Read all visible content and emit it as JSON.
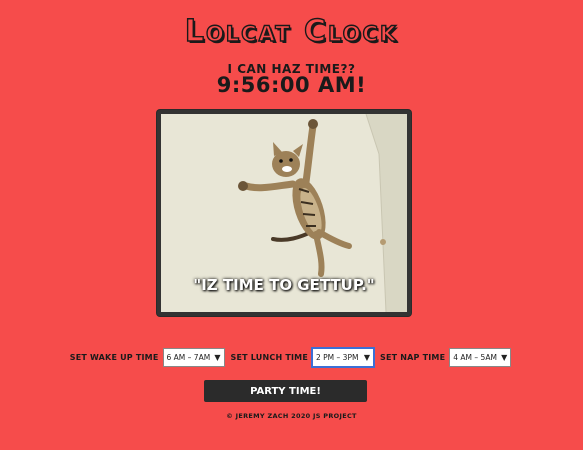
{
  "header": {
    "title": "Lolcat Clock",
    "subtitle": "I can haz time??",
    "time": "9:56:00 AM!"
  },
  "image": {
    "caption": "\"IZ TIME TO GETTUP.\"",
    "subject": "cat-photo"
  },
  "controls": {
    "wakeup_label": "Set Wake Up Time",
    "wakeup_value": "6 AM – 7AM",
    "lunch_label": "Set Lunch Time",
    "lunch_value": "2 PM – 3PM",
    "nap_label": "Set Nap Time",
    "nap_value": "4 AM – 5AM"
  },
  "party_button": "Party Time!",
  "footer": "© Jeremy Zach 2020 JS Project",
  "colors": {
    "background": "#f64c4b",
    "text": "#1a1a1a",
    "button": "#2b2b2b"
  }
}
